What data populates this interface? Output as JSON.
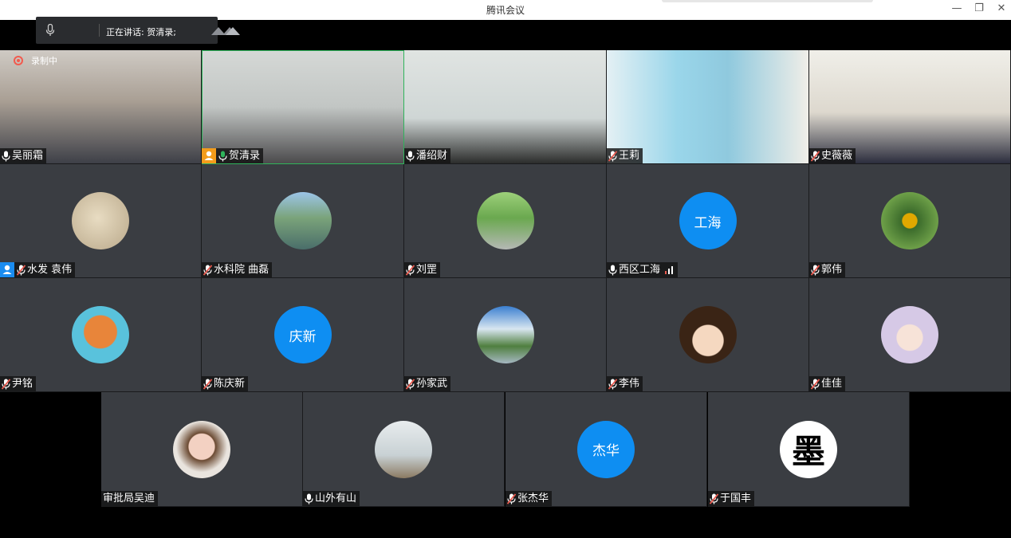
{
  "window": {
    "title": "腾讯会议",
    "min_label": "—",
    "max_label": "❐",
    "close_label": "✕"
  },
  "speaking": {
    "prefix": "正在讲话: ",
    "name": "贺清录;"
  },
  "recording": {
    "label": "录制中"
  },
  "colors": {
    "accent": "#0e8ef2",
    "host_orange": "#f39c1b",
    "mic_on": "#2fb45b",
    "mic_muted": "#e85a4f"
  },
  "participants": [
    {
      "name": "吴丽霜",
      "kind": "video",
      "mic": "on"
    },
    {
      "name": "贺清录",
      "kind": "video",
      "mic": "speaking",
      "host": "orange"
    },
    {
      "name": "潘绍财",
      "kind": "video",
      "mic": "on"
    },
    {
      "name": "王莉",
      "kind": "video",
      "mic": "muted"
    },
    {
      "name": "史薇薇",
      "kind": "video",
      "mic": "muted"
    },
    {
      "name": "水发 袁伟",
      "kind": "avatar",
      "avatar_icon": "ink-painting-avatar-icon",
      "mic": "muted",
      "host": "blue"
    },
    {
      "name": "水科院 曲磊",
      "kind": "avatar",
      "avatar_icon": "lake-landscape-avatar-icon",
      "mic": "muted"
    },
    {
      "name": "刘罡",
      "kind": "avatar",
      "avatar_icon": "road-avatar-icon",
      "mic": "muted"
    },
    {
      "name": "西区工海",
      "kind": "text",
      "avatar_text": "工海",
      "mic": "on",
      "signal": true
    },
    {
      "name": "郭伟",
      "kind": "avatar",
      "avatar_icon": "sunflower-avatar-icon",
      "mic": "muted"
    },
    {
      "name": "尹铭",
      "kind": "avatar",
      "avatar_icon": "fox-cartoon-avatar-icon",
      "mic": "muted"
    },
    {
      "name": "陈庆新",
      "kind": "text",
      "avatar_text": "庆新",
      "mic": "muted"
    },
    {
      "name": "孙家武",
      "kind": "avatar",
      "avatar_icon": "mountain-avatar-icon",
      "mic": "muted"
    },
    {
      "name": "李伟",
      "kind": "avatar",
      "avatar_icon": "anime-boy-avatar-icon",
      "mic": "muted"
    },
    {
      "name": "佳佳",
      "kind": "avatar",
      "avatar_icon": "girl-cartoon-avatar-icon",
      "mic": "muted"
    },
    {
      "name": "审批局吴迪",
      "kind": "avatar",
      "avatar_icon": "woman-photo-avatar-icon",
      "mic": "none"
    },
    {
      "name": "山外有山",
      "kind": "avatar",
      "avatar_icon": "misty-figure-avatar-icon",
      "mic": "on"
    },
    {
      "name": "张杰华",
      "kind": "text",
      "avatar_text": "杰华",
      "mic": "muted"
    },
    {
      "name": "于国丰",
      "kind": "avatar",
      "avatar_icon": "calligraphy-mo-avatar-icon",
      "avatar_char": "墨",
      "mic": "muted"
    }
  ]
}
